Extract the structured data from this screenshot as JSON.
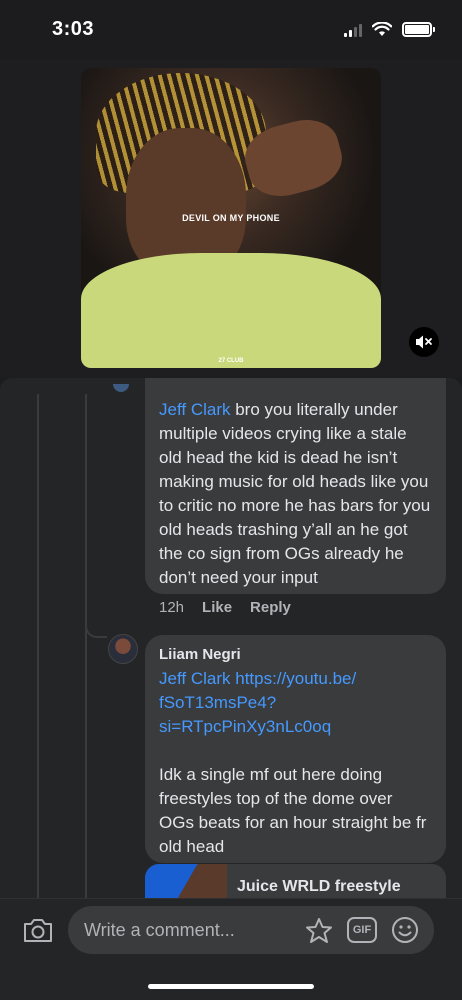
{
  "status_bar": {
    "time": "3:03",
    "icons": [
      "cellular-signal-icon",
      "wifi-icon",
      "battery-icon"
    ]
  },
  "video": {
    "caption": "DEVIL ON MY PHONE",
    "watermark": "27 CLUB",
    "mute_icon": "speaker-muted-icon"
  },
  "comments": [
    {
      "author": "",
      "mention": "Jeff Clark",
      "text": " bro you literally under multiple videos crying like a stale old head the kid is dead he isn’t making music for old heads like you to critic no more he has bars for you old heads trashing y’all an he got the co sign from OGs already he don’t need your input",
      "time": "12h",
      "like_label": "Like",
      "reply_label": "Reply"
    },
    {
      "author": "Liiam Negri",
      "mention": "Jeff Clark",
      "link": "https://youtu.be/\nfSoT13msPe4?\nsi=RTpcPinXy3nLc0oq",
      "text": "Idk a single mf out here doing freestyles top of the dome over OGs beats for an hour straight be fr old head",
      "link_preview_title": "Juice WRLD freestyle"
    }
  ],
  "composer": {
    "placeholder": "Write a comment...",
    "gif_label": "GIF",
    "icons": [
      "camera-icon",
      "sticker-icon",
      "gif-icon",
      "emoji-icon"
    ]
  },
  "colors": {
    "background": "#1c1c1e",
    "bubble": "#3a3b3c",
    "link": "#4599ff",
    "secondary_text": "#b0b3b8"
  }
}
